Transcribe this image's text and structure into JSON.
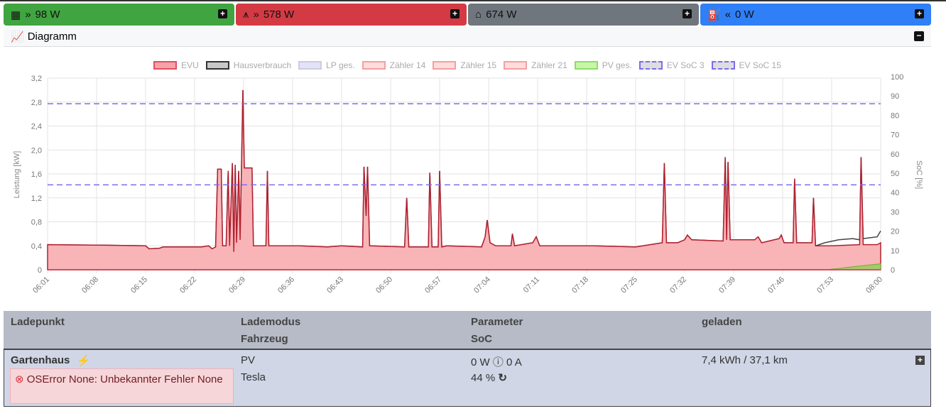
{
  "top": [
    {
      "icon": "solar-panel-icon",
      "arrow": "»",
      "value": "98 W",
      "color": "#40a540"
    },
    {
      "icon": "power-pylon-icon",
      "arrow": "»",
      "value": "578 W",
      "color": "#d43a44"
    },
    {
      "icon": "house-icon",
      "arrow": "",
      "value": "674 W",
      "color": "#6f767d"
    },
    {
      "icon": "charging-station-icon",
      "arrow": "«",
      "value": "0 W",
      "color": "#2f7ff6"
    }
  ],
  "diagram": {
    "title": "Diagramm"
  },
  "chart_data": {
    "type": "line",
    "legend": [
      "EVU",
      "Hausverbrauch",
      "LP ges.",
      "Zähler 14",
      "Zähler 15",
      "Zähler 21",
      "PV ges.",
      "EV SoC 3",
      "EV SoC 15"
    ],
    "legend_colors": [
      [
        "#f5a3a8",
        "#e05060"
      ],
      [
        "#c8c8c8",
        "#333"
      ],
      [
        "#e4e2f8",
        "#ccd"
      ],
      [
        "#fdd",
        "#f3a0a0"
      ],
      [
        "#fdd",
        "#f3a0a0"
      ],
      [
        "#fdd",
        "#f3a0a0"
      ],
      [
        "#c9f5a8",
        "#8ddc6a"
      ],
      [
        "#ddd",
        "#7b6cf0"
      ],
      [
        "#ddd",
        "#7b6cf0"
      ]
    ],
    "ylabel": "Leistung [kW]",
    "y2label": "SoC [%]",
    "ylim": [
      0,
      3.2
    ],
    "yticks": [
      "0",
      "0,4",
      "0,8",
      "1,2",
      "1,6",
      "2,0",
      "2,4",
      "2,8",
      "3,2"
    ],
    "y2lim": [
      0,
      100
    ],
    "y2ticks": [
      "0",
      "10",
      "20",
      "30",
      "40",
      "50",
      "60",
      "70",
      "80",
      "90",
      "100"
    ],
    "xticks": [
      "06:01",
      "06:08",
      "06:15",
      "06:22",
      "06:29",
      "06:36",
      "06:43",
      "06:50",
      "06:57",
      "07:04",
      "07:11",
      "07:18",
      "07:25",
      "07:32",
      "07:39",
      "07:46",
      "07:53",
      "08:00"
    ],
    "x_unit": "minutes since 06:01",
    "evu": [
      [
        0,
        0.42
      ],
      [
        8,
        0.41
      ],
      [
        14,
        0.4
      ],
      [
        14.5,
        0.35
      ],
      [
        16,
        0.36
      ],
      [
        16.5,
        0.38
      ],
      [
        22,
        0.38
      ],
      [
        23,
        0.4
      ],
      [
        23.5,
        0.35
      ],
      [
        24,
        0.38
      ],
      [
        24.3,
        1.68
      ],
      [
        24.8,
        1.68
      ],
      [
        25,
        0.4
      ],
      [
        25.5,
        0.4
      ],
      [
        25.8,
        1.65
      ],
      [
        26,
        0.4
      ],
      [
        26.4,
        1.78
      ],
      [
        26.6,
        0.3
      ],
      [
        26.8,
        1.75
      ],
      [
        27,
        0.45
      ],
      [
        27.3,
        1.65
      ],
      [
        27.5,
        0.5
      ],
      [
        27.7,
        1.7
      ],
      [
        27.9,
        3.0
      ],
      [
        28.1,
        1.7
      ],
      [
        29.2,
        1.7
      ],
      [
        29.4,
        0.4
      ],
      [
        31.2,
        0.4
      ],
      [
        31.4,
        1.65
      ],
      [
        31.6,
        0.4
      ],
      [
        36,
        0.4
      ],
      [
        40,
        0.38
      ],
      [
        42,
        0.4
      ],
      [
        45,
        0.38
      ],
      [
        45.2,
        1.72
      ],
      [
        45.5,
        0.9
      ],
      [
        45.7,
        1.72
      ],
      [
        46,
        0.4
      ],
      [
        51,
        0.38
      ],
      [
        51.3,
        1.2
      ],
      [
        51.6,
        0.38
      ],
      [
        54.4,
        0.38
      ],
      [
        54.6,
        1.62
      ],
      [
        54.9,
        0.38
      ],
      [
        55.8,
        0.38
      ],
      [
        56,
        1.65
      ],
      [
        56.3,
        0.38
      ],
      [
        57,
        0.4
      ],
      [
        62,
        0.38
      ],
      [
        62.5,
        0.55
      ],
      [
        62.8,
        0.83
      ],
      [
        63.2,
        0.45
      ],
      [
        64,
        0.4
      ],
      [
        66.2,
        0.4
      ],
      [
        66.4,
        0.6
      ],
      [
        66.7,
        0.4
      ],
      [
        69.3,
        0.45
      ],
      [
        69.8,
        0.55
      ],
      [
        70.3,
        0.4
      ],
      [
        78,
        0.4
      ],
      [
        84,
        0.38
      ],
      [
        87.8,
        0.45
      ],
      [
        88.1,
        1.78
      ],
      [
        88.4,
        0.45
      ],
      [
        90,
        0.45
      ],
      [
        91,
        0.5
      ],
      [
        91.4,
        0.58
      ],
      [
        92,
        0.5
      ],
      [
        96.5,
        0.48
      ],
      [
        96.8,
        1.88
      ],
      [
        97,
        0.5
      ],
      [
        97.2,
        1.8
      ],
      [
        97.5,
        0.5
      ],
      [
        101,
        0.5
      ],
      [
        101.5,
        0.55
      ],
      [
        102,
        0.45
      ],
      [
        104.5,
        0.52
      ],
      [
        104.8,
        0.58
      ],
      [
        105.2,
        0.45
      ],
      [
        106.5,
        0.45
      ],
      [
        106.7,
        1.52
      ],
      [
        107,
        0.45
      ],
      [
        109.2,
        0.45
      ],
      [
        109.4,
        1.2
      ],
      [
        109.7,
        0.4
      ],
      [
        112,
        0.4
      ],
      [
        116,
        0.42
      ],
      [
        116.2,
        1.88
      ],
      [
        116.5,
        0.42
      ],
      [
        118.5,
        0.42
      ],
      [
        119,
        0.45
      ]
    ],
    "haus_tail": [
      [
        111,
        0.45
      ],
      [
        113,
        0.5
      ],
      [
        115,
        0.52
      ],
      [
        116,
        0.5
      ],
      [
        116.2,
        1.88
      ],
      [
        116.5,
        0.52
      ],
      [
        118.5,
        0.55
      ],
      [
        119,
        0.65
      ]
    ],
    "pv": [
      [
        0,
        0
      ],
      [
        111,
        0
      ],
      [
        113,
        0.02
      ],
      [
        115,
        0.05
      ],
      [
        119,
        0.1
      ]
    ],
    "ev_soc_3": 86,
    "ev_soc_15": 44
  },
  "table": {
    "headers": {
      "ladepunkt": "Ladepunkt",
      "lademodus": "Lademodus",
      "fahrzeug": "Fahrzeug",
      "parameter": "Parameter",
      "soc": "SoC",
      "geladen": "geladen"
    },
    "row": {
      "name": "Gartenhaus",
      "error": "OSError None: Unbekannter Fehler None",
      "mode": "PV",
      "vehicle": "Tesla",
      "power": "0 W",
      "current": "0 A",
      "soc": "44 %",
      "charged": "7,4 kWh / 37,1 km"
    }
  }
}
